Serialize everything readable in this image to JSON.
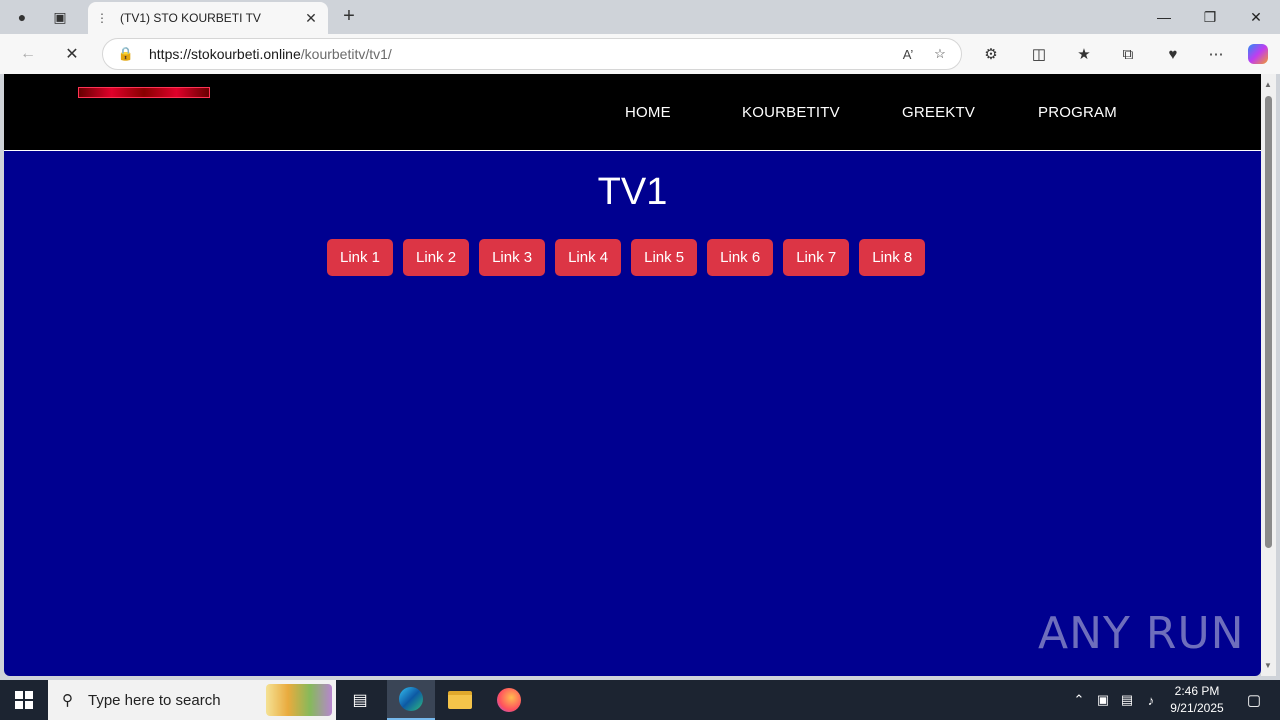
{
  "browser": {
    "tab_title": "(TV1) STO KOURBETI TV",
    "url_host": "https://stokourbeti.online",
    "url_path": "/kourbetitv/tv1/"
  },
  "page": {
    "nav": [
      "HOME",
      "KOURBETITV",
      "GREEKTV",
      "PROGRAM"
    ],
    "title": "TV1",
    "links": [
      "Link 1",
      "Link 2",
      "Link 3",
      "Link 4",
      "Link 5",
      "Link 6",
      "Link 7",
      "Link 8"
    ],
    "watermark": "ANY RUN"
  },
  "taskbar": {
    "search_placeholder": "Type here to search",
    "time": "2:46 PM",
    "date": "9/21/2025"
  },
  "colors": {
    "page_bg": "#000090",
    "header_bg": "#000000",
    "link_button": "#dc3545"
  }
}
